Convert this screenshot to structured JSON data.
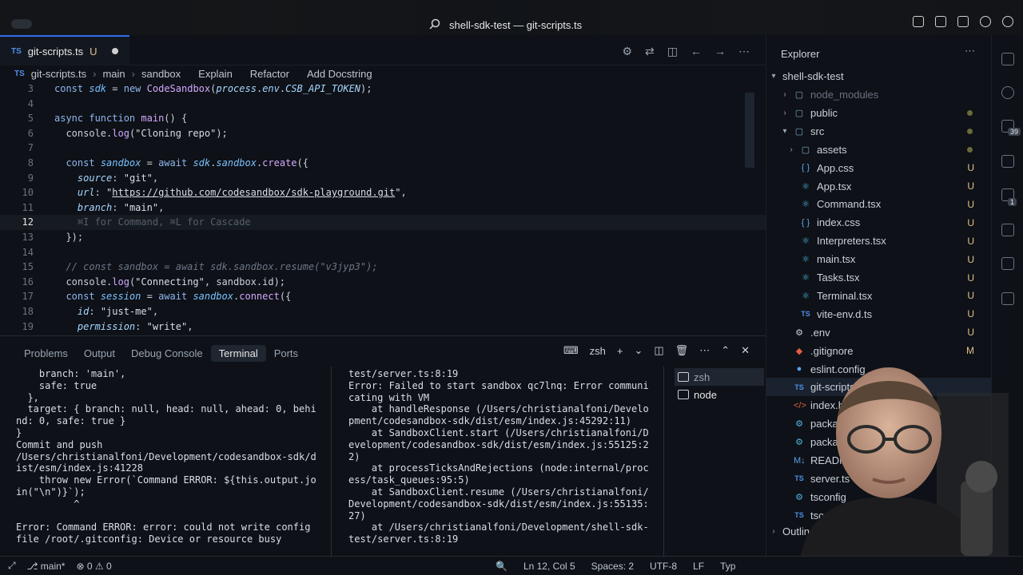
{
  "window": {
    "title": "shell-sdk-test — git-scripts.ts"
  },
  "tab": {
    "badge": "TS",
    "label": "git-scripts.ts",
    "status": "U"
  },
  "breadcrumbs": {
    "badge": "TS",
    "file": "git-scripts.ts",
    "fn": "main",
    "var": "sandbox",
    "lens": [
      "Explain",
      "Refactor",
      "Add Docstring"
    ]
  },
  "editor": {
    "cursor_line": 12,
    "hint": "⌘I for Command, ⌘L for Cascade",
    "line_numbers": [
      "3",
      "4",
      "5",
      "6",
      "7",
      "8",
      "9",
      "10",
      "11",
      "12",
      "13",
      "14",
      "15",
      "16",
      "17",
      "18",
      "19"
    ]
  },
  "panel": {
    "tabs": [
      "Problems",
      "Output",
      "Debug Console",
      "Terminal",
      "Ports"
    ],
    "active_tab": "Terminal",
    "shell_label": "zsh",
    "terminal_left": [
      "    branch: 'main',",
      "    safe: true",
      "  },",
      "  target: { branch: null, head: null, ahead: 0, behi",
      "nd: 0, safe: true }",
      "}",
      "Commit and push",
      "/Users/christianalfoni/Development/codesandbox-sdk/d",
      "ist/esm/index.js:41228",
      "    throw new Error(`Command ERROR: ${this.output.jo",
      "in(\"\\n\")}`);",
      "          ^",
      "",
      "Error: Command ERROR: error: could not write config",
      "file /root/.gitconfig: Device or resource busy"
    ],
    "terminal_right": [
      "test/server.ts:8:19",
      "Error: Failed to start sandbox qc7lnq: Error communi",
      "cating with VM",
      "    at handleResponse (/Users/christianalfoni/Develo",
      "pment/codesandbox-sdk/dist/esm/index.js:45292:11)",
      "    at SandboxClient.start (/Users/christianalfoni/D",
      "evelopment/codesandbox-sdk/dist/esm/index.js:55125:2",
      "2)",
      "    at processTicksAndRejections (node:internal/proc",
      "ess/task_queues:95:5)",
      "    at SandboxClient.resume (/Users/christianalfoni/",
      "Development/codesandbox-sdk/dist/esm/index.js:55135:",
      "27)",
      "    at /Users/christianalfoni/Development/shell-sdk-",
      "test/server.ts:8:19"
    ],
    "terminals": [
      "zsh",
      "node"
    ]
  },
  "explorer": {
    "title": "Explorer",
    "root": "shell-sdk-test",
    "items": [
      {
        "label": "node_modules",
        "kind": "folder",
        "depth": 1,
        "badge": "",
        "dim": true
      },
      {
        "label": "public",
        "kind": "folder",
        "depth": 1,
        "badge": "•"
      },
      {
        "label": "src",
        "kind": "folder-open",
        "depth": 1,
        "badge": "•"
      },
      {
        "label": "assets",
        "kind": "folder",
        "depth": 2,
        "badge": "•"
      },
      {
        "label": "App.css",
        "kind": "css",
        "depth": 2,
        "badge": "U"
      },
      {
        "label": "App.tsx",
        "kind": "react",
        "depth": 2,
        "badge": "U"
      },
      {
        "label": "Command.tsx",
        "kind": "react",
        "depth": 2,
        "badge": "U"
      },
      {
        "label": "index.css",
        "kind": "css",
        "depth": 2,
        "badge": "U"
      },
      {
        "label": "Interpreters.tsx",
        "kind": "react",
        "depth": 2,
        "badge": "U"
      },
      {
        "label": "main.tsx",
        "kind": "react",
        "depth": 2,
        "badge": "U"
      },
      {
        "label": "Tasks.tsx",
        "kind": "react",
        "depth": 2,
        "badge": "U"
      },
      {
        "label": "Terminal.tsx",
        "kind": "react",
        "depth": 2,
        "badge": "U"
      },
      {
        "label": "vite-env.d.ts",
        "kind": "ts",
        "depth": 2,
        "badge": "U"
      },
      {
        "label": ".env",
        "kind": "gear",
        "depth": 1,
        "badge": "U"
      },
      {
        "label": ".gitignore",
        "kind": "git",
        "depth": 1,
        "badge": "M"
      },
      {
        "label": "eslint.config",
        "kind": "eslint",
        "depth": 1,
        "badge": ""
      },
      {
        "label": "git-scripts",
        "kind": "ts",
        "depth": 1,
        "badge": "",
        "selected": true
      },
      {
        "label": "index.html",
        "kind": "html",
        "depth": 1,
        "badge": ""
      },
      {
        "label": "package",
        "kind": "json",
        "depth": 1,
        "badge": ""
      },
      {
        "label": "package",
        "kind": "json",
        "depth": 1,
        "badge": ""
      },
      {
        "label": "README",
        "kind": "md",
        "depth": 1,
        "badge": ""
      },
      {
        "label": "server.ts",
        "kind": "ts",
        "depth": 1,
        "badge": ""
      },
      {
        "label": "tsconfig",
        "kind": "json",
        "depth": 1,
        "badge": ""
      },
      {
        "label": "tscon",
        "kind": "ts",
        "depth": 1,
        "badge": ""
      }
    ],
    "outline": "Outline"
  },
  "activity": {
    "badges": [
      "39",
      "1"
    ]
  },
  "statusbar": {
    "branch": "main*",
    "problems": "⊗ 0 ⚠ 0",
    "position": "Ln 12, Col 5",
    "spaces": "Spaces: 2",
    "encoding": "UTF-8",
    "eol": "LF",
    "lang": "Typ"
  },
  "colors": {
    "background": "#0e1117",
    "accent": "#2f6fed",
    "untracked": "#e2c08d"
  }
}
